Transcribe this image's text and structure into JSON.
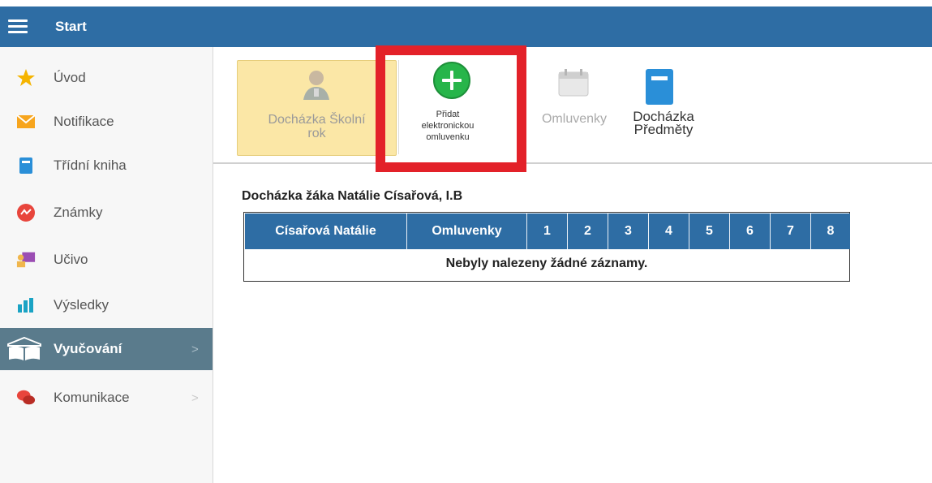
{
  "header": {
    "title": "Start",
    "menu_icon": "hamburger-menu-icon",
    "color": "#2e6da4"
  },
  "sidebar": {
    "items": [
      {
        "label": "Úvod",
        "icon": "star-icon",
        "has_submenu": false,
        "active": false
      },
      {
        "label": "Notifikace",
        "icon": "envelope-icon",
        "has_submenu": false,
        "active": false
      },
      {
        "label": "Třídní kniha",
        "icon": "notebook-icon",
        "has_submenu": false,
        "active": false
      },
      {
        "label": "Známky",
        "icon": "grades-icon",
        "has_submenu": false,
        "active": false
      },
      {
        "label": "Učivo",
        "icon": "teacher-icon",
        "has_submenu": false,
        "active": false
      },
      {
        "label": "Výsledky",
        "icon": "bar-chart-icon",
        "has_submenu": false,
        "active": false
      },
      {
        "label": "Vyučování",
        "icon": "open-book-icon",
        "has_submenu": true,
        "active": true
      },
      {
        "label": "Komunikace",
        "icon": "chat-bubbles-icon",
        "has_submenu": true,
        "active": false
      }
    ],
    "chevron": ">"
  },
  "toolbar": {
    "buttons": [
      {
        "line1": "Docházka Školní",
        "line2": "rok",
        "icon": "student-icon",
        "selected": true
      },
      {
        "line1": "Přidat",
        "line2": "elektronickou",
        "line3": "omluvenku",
        "icon": "plus-circle-icon",
        "highlighted": true
      },
      {
        "label": "Omluvenky",
        "icon": "calendar-icon",
        "disabled": true
      },
      {
        "line1": "Docházka",
        "line2": "Předměty",
        "icon": "book-icon"
      }
    ]
  },
  "content": {
    "heading": "Docházka žáka Natálie Císařová, I.B",
    "table": {
      "columns": [
        "Císařová Natálie",
        "Omluvenky",
        "1",
        "2",
        "3",
        "4",
        "5",
        "6",
        "7",
        "8"
      ],
      "empty_message": "Nebyly nalezeny žádné záznamy."
    }
  },
  "colors": {
    "accent": "#2e6da4",
    "highlight_box": "#e32129",
    "selected_tool": "#fbe7a6",
    "active_nav": "#5a7b8c"
  }
}
